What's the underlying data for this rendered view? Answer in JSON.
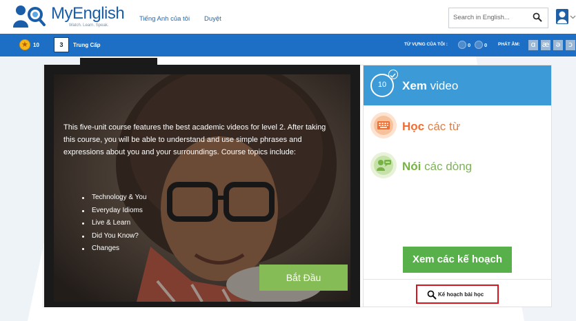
{
  "header": {
    "logo_text": "MyEnglish",
    "logo_tagline": "Watch. Learn. Speak.",
    "nav": [
      "Tiếng Anh của tôi",
      "Duyệt"
    ],
    "search_placeholder": "Search in English..."
  },
  "toolbar": {
    "points": "10",
    "level_number": "3",
    "level_name": "Trung Cấp",
    "vocab_label": "TỪ VỰNG CỦA TÔI :",
    "vocab_counts": [
      "0",
      "0"
    ],
    "pron_label": "PHÁT ÂM:",
    "pron_symbols": [
      "ɑ",
      "æ",
      "ə",
      "ɔ"
    ]
  },
  "course": {
    "description": "This five-unit course features the best academic videos for level 2. After taking this course, you will be able to understand and use simple phrases and expressions about you and your surroundings. Course topics include:",
    "topics": [
      "Technology & You",
      "Everyday Idioms",
      "Live & Learn",
      "Did You Know?",
      "Changes"
    ],
    "start_label": "Bắt Đầu"
  },
  "activities": {
    "video_count": "10",
    "video": {
      "bold": "Xem",
      "rest": " video"
    },
    "learn": {
      "bold": "Học",
      "rest": " các từ"
    },
    "speak": {
      "bold": "Nói",
      "rest": " các dòng"
    },
    "plans_label": "Xem các kế hoạch",
    "lesson_plan_label": "Kế hoạch bài học"
  },
  "colors": {
    "brand_blue": "#1d6fc5",
    "video_blue": "#3c9ad7",
    "green": "#58b04a",
    "start_green": "#86bc55",
    "orange": "#ee6e35",
    "highlight_red": "#d8141c"
  }
}
